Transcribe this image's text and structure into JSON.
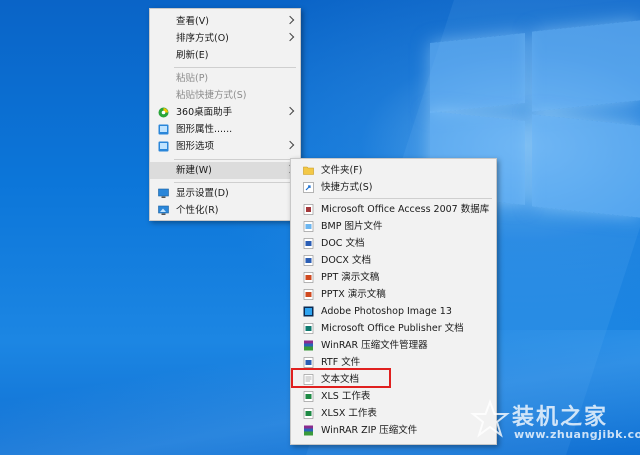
{
  "context_menu": {
    "items": [
      {
        "label": "查看(V)",
        "has_submenu": true,
        "disabled": false
      },
      {
        "label": "排序方式(O)",
        "has_submenu": true,
        "disabled": false
      },
      {
        "label": "刷新(E)",
        "has_submenu": false,
        "disabled": false
      },
      {
        "label": "粘贴(P)",
        "has_submenu": false,
        "disabled": true
      },
      {
        "label": "粘贴快捷方式(S)",
        "has_submenu": false,
        "disabled": true
      },
      {
        "label": "360桌面助手",
        "has_submenu": true,
        "disabled": false,
        "icon": "360-assistant-icon"
      },
      {
        "label": "图形属性......",
        "has_submenu": false,
        "disabled": false,
        "icon": "graphics-properties-icon"
      },
      {
        "label": "图形选项",
        "has_submenu": true,
        "disabled": false,
        "icon": "graphics-options-icon"
      },
      {
        "label": "新建(W)",
        "has_submenu": true,
        "disabled": false,
        "active": true
      },
      {
        "label": "显示设置(D)",
        "has_submenu": false,
        "disabled": false,
        "icon": "display-settings-icon"
      },
      {
        "label": "个性化(R)",
        "has_submenu": false,
        "disabled": false,
        "icon": "personalize-icon"
      }
    ]
  },
  "new_submenu": {
    "items": [
      {
        "label": "文件夹(F)",
        "icon": "folder-icon"
      },
      {
        "label": "快捷方式(S)",
        "icon": "shortcut-icon"
      },
      {
        "label": "Microsoft Office Access 2007 数据库",
        "icon": "access-database-icon"
      },
      {
        "label": "BMP 图片文件",
        "icon": "bmp-file-icon"
      },
      {
        "label": "DOC 文档",
        "icon": "doc-file-icon"
      },
      {
        "label": "DOCX 文档",
        "icon": "docx-file-icon"
      },
      {
        "label": "PPT 演示文稿",
        "icon": "ppt-file-icon"
      },
      {
        "label": "PPTX 演示文稿",
        "icon": "pptx-file-icon"
      },
      {
        "label": "Adobe Photoshop Image 13",
        "icon": "photoshop-icon"
      },
      {
        "label": "Microsoft Office Publisher 文档",
        "icon": "publisher-icon"
      },
      {
        "label": "WinRAR 压缩文件管理器",
        "icon": "winrar-icon"
      },
      {
        "label": "RTF 文件",
        "icon": "rtf-file-icon"
      },
      {
        "label": "文本文档",
        "icon": "text-file-icon",
        "highlighted": true
      },
      {
        "label": "XLS 工作表",
        "icon": "xls-file-icon"
      },
      {
        "label": "XLSX 工作表",
        "icon": "xlsx-file-icon"
      },
      {
        "label": "WinRAR ZIP 压缩文件",
        "icon": "winrar-zip-icon"
      }
    ]
  },
  "watermark": {
    "title": "装机之家",
    "url": "www.zhuangjibk.com"
  },
  "colors": {
    "highlight_border": "#e0201f",
    "menu_bg": "#f2f2f2",
    "desktop_blue": "#0c76d9"
  }
}
